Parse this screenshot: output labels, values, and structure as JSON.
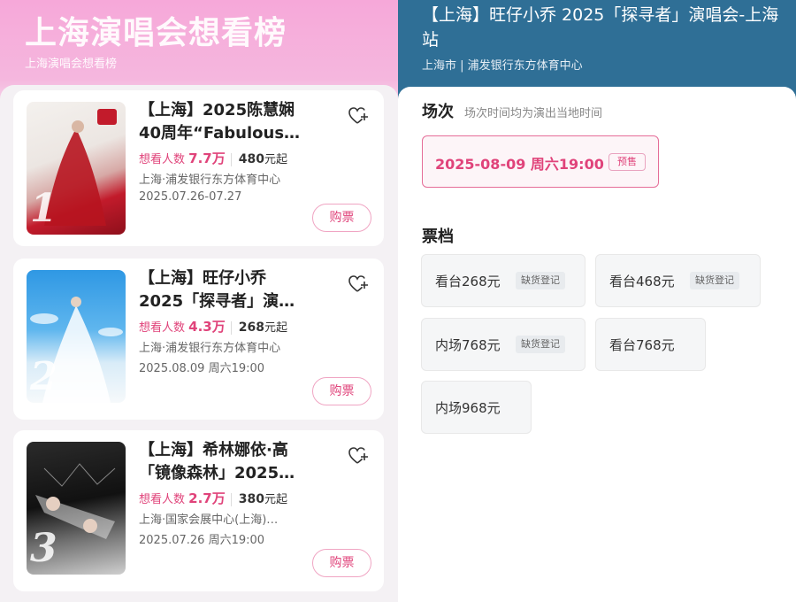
{
  "ranking": {
    "title": "上海演唱会想看榜",
    "subtitle": "上海演唱会想看榜",
    "buy_label": "购票",
    "items": [
      {
        "rank": "1",
        "title_line1": "【上海】2025陈慧娴",
        "title_line2": "40周年“Fabulous…",
        "want_prefix": "想看人数",
        "want_count": "7.7万",
        "price_num": "480",
        "price_suffix": "元起",
        "venue": "上海·浦发银行东方体育中心",
        "date": "2025.07.26-07.27",
        "poster_colors": [
          "#f2f0ee",
          "#c21b2b"
        ],
        "icon": "heart-plus-icon"
      },
      {
        "rank": "2",
        "title_line1": "【上海】旺仔小乔",
        "title_line2": "2025「探寻者」演…",
        "want_prefix": "想看人数",
        "want_count": "4.3万",
        "price_num": "268",
        "price_suffix": "元起",
        "venue": "上海·浦发银行东方体育中心",
        "date": "2025.08.09 周六19:00",
        "poster_colors": [
          "#3aa0e6",
          "#eaf4fb"
        ],
        "icon": "heart-plus-icon"
      },
      {
        "rank": "3",
        "title_line1": "【上海】希林娜依·高",
        "title_line2": "「镜像森林」2025…",
        "want_prefix": "想看人数",
        "want_count": "2.7万",
        "price_num": "380",
        "price_suffix": "元起",
        "venue": "上海·国家会展中心(上海)…",
        "date": "2025.07.26 周六19:00",
        "poster_colors": [
          "#1a1a1a",
          "#bfbfbf"
        ],
        "icon": "heart-plus-icon"
      }
    ]
  },
  "detail": {
    "title": "【上海】旺仔小乔 2025「探寻者」演唱会-上海站",
    "subtitle": "上海市 | 浦发银行东方体育中心",
    "session_heading": "场次",
    "session_note": "场次时间均为演出当地时间",
    "session_value": "2025-08-09  周六19:00",
    "session_tag": "预售",
    "tier_heading": "票档",
    "tiers": [
      {
        "label": "看台268元",
        "tag": "缺货登记"
      },
      {
        "label": "看台468元",
        "tag": "缺货登记"
      },
      {
        "label": "内场768元",
        "tag": "缺货登记"
      },
      {
        "label": "看台768元",
        "tag": ""
      },
      {
        "label": "内场968元",
        "tag": ""
      }
    ]
  },
  "colors": {
    "accent_pink": "#e0437a",
    "header_blue": "#2f6f96",
    "header_pink": "#f6a8d9"
  }
}
